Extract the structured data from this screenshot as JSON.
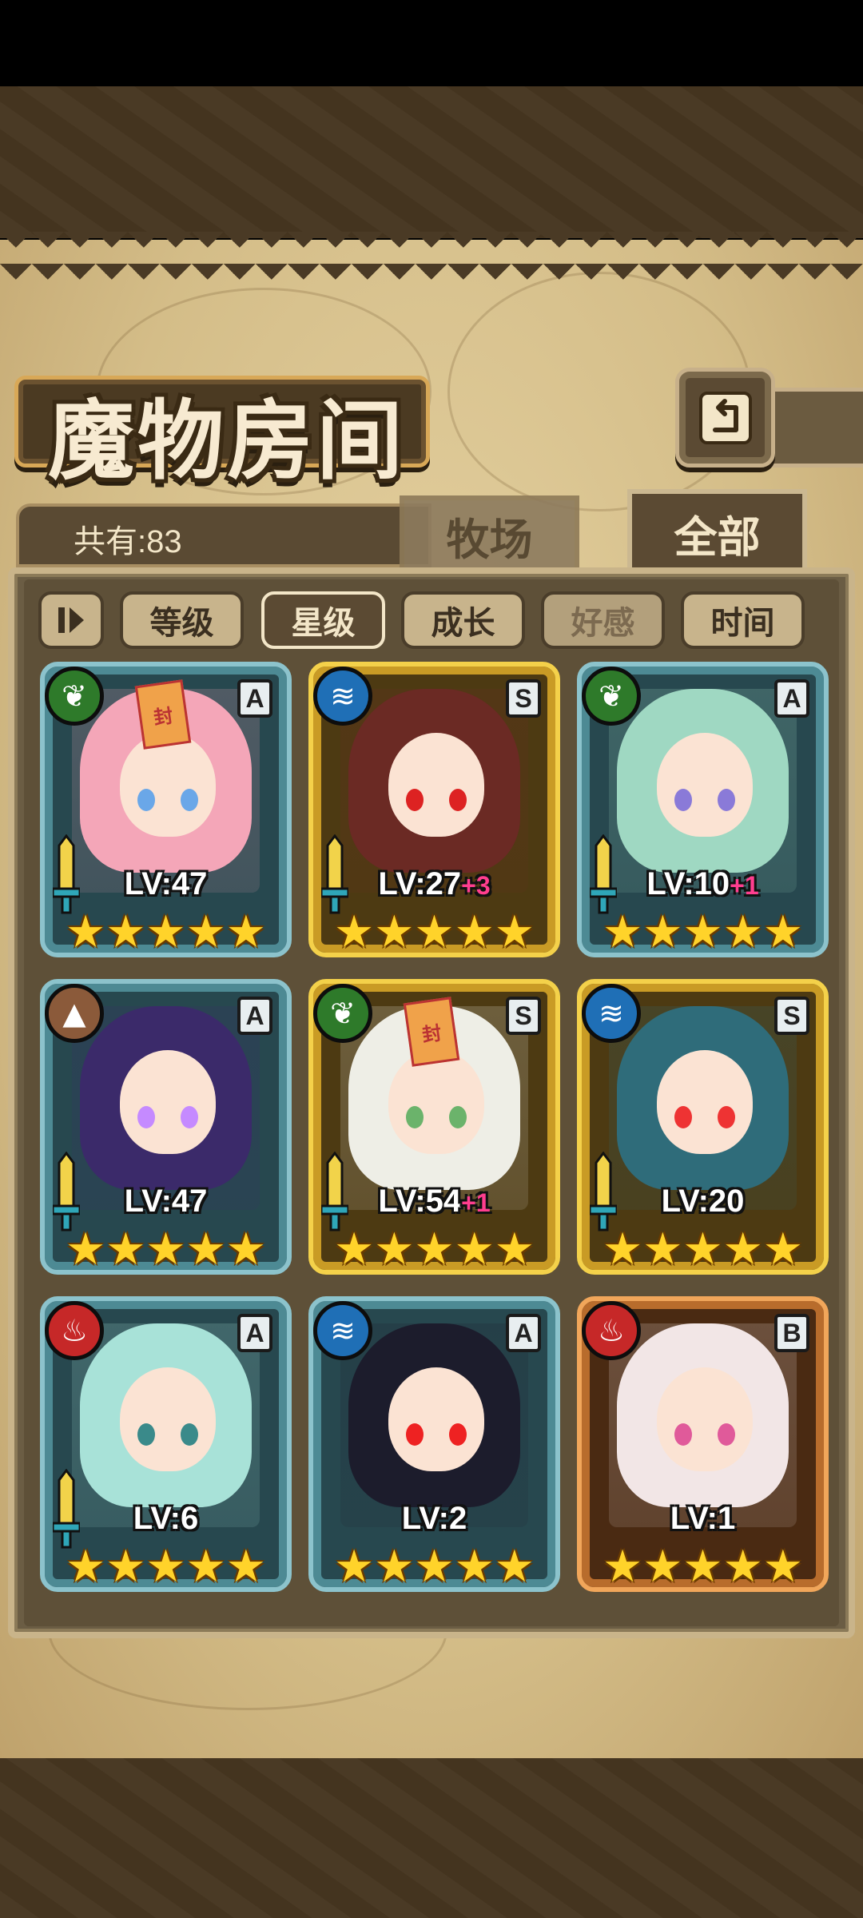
{
  "title": "魔物房间",
  "count_label": "共有:83",
  "tabs": [
    {
      "label": "牧场",
      "active": false
    },
    {
      "label": "全部",
      "active": true
    }
  ],
  "sort_buttons": [
    {
      "label": "等级",
      "state": "normal"
    },
    {
      "label": "星级",
      "state": "active"
    },
    {
      "label": "成长",
      "state": "normal"
    },
    {
      "label": "好感",
      "state": "dim"
    },
    {
      "label": "时间",
      "state": "normal"
    }
  ],
  "icons": {
    "back": "back-arrow-icon",
    "sort_toggle": "sort-toggle-icon"
  },
  "cards": [
    {
      "element": "leaf",
      "element_color": "#2e7a2a",
      "rank": "A",
      "frame": "blue",
      "level": "LV:47",
      "plus": "",
      "stars": "★★★★★",
      "sealed": true,
      "seal_text": "封",
      "hair": "#f4a6b8",
      "eye": "#6aa7e8"
    },
    {
      "element": "water",
      "element_color": "#1f6fb6",
      "rank": "S",
      "frame": "gold",
      "level": "LV:27",
      "plus": "+3",
      "stars": "★★★★★",
      "sealed": false,
      "seal_text": "",
      "hair": "#6b2a24",
      "eye": "#d22"
    },
    {
      "element": "leaf",
      "element_color": "#2e7a2a",
      "rank": "A",
      "frame": "blue",
      "level": "LV:10",
      "plus": "+1",
      "stars": "★★★★★",
      "sealed": false,
      "seal_text": "",
      "hair": "#9fd8c2",
      "eye": "#8a7ad8"
    },
    {
      "element": "earth",
      "element_color": "#8b5a3a",
      "rank": "A",
      "frame": "blue",
      "level": "LV:47",
      "plus": "",
      "stars": "★★★★★",
      "sealed": false,
      "seal_text": "",
      "hair": "#3b2a6a",
      "eye": "#c58aff"
    },
    {
      "element": "leaf",
      "element_color": "#2e7a2a",
      "rank": "S",
      "frame": "gold",
      "level": "LV:54",
      "plus": "+1",
      "stars": "★★★★★",
      "sealed": true,
      "seal_text": "封",
      "hair": "#eeeee6",
      "eye": "#6bb36b"
    },
    {
      "element": "water",
      "element_color": "#1f6fb6",
      "rank": "S",
      "frame": "gold",
      "level": "LV:20",
      "plus": "",
      "stars": "★★★★★",
      "sealed": false,
      "seal_text": "",
      "hair": "#2f6c7a",
      "eye": "#e33"
    },
    {
      "element": "fire",
      "element_color": "#c62828",
      "rank": "A",
      "frame": "blue",
      "level": "LV:6",
      "plus": "",
      "stars": "★★★★★",
      "sealed": false,
      "seal_text": "",
      "hair": "#a8e2d8",
      "eye": "#3a8a8a"
    },
    {
      "element": "water",
      "element_color": "#1f6fb6",
      "rank": "A",
      "frame": "blue",
      "level": "LV:2",
      "plus": "",
      "stars": "★★★★★",
      "sealed": false,
      "seal_text": "",
      "hair": "#1c1c2c",
      "eye": "#e22"
    },
    {
      "element": "fire",
      "element_color": "#c62828",
      "rank": "B",
      "frame": "bronze",
      "level": "LV:1",
      "plus": "",
      "stars": "★★★★★",
      "sealed": false,
      "seal_text": "",
      "hair": "#f2e6e6",
      "eye": "#e05a9a"
    }
  ]
}
